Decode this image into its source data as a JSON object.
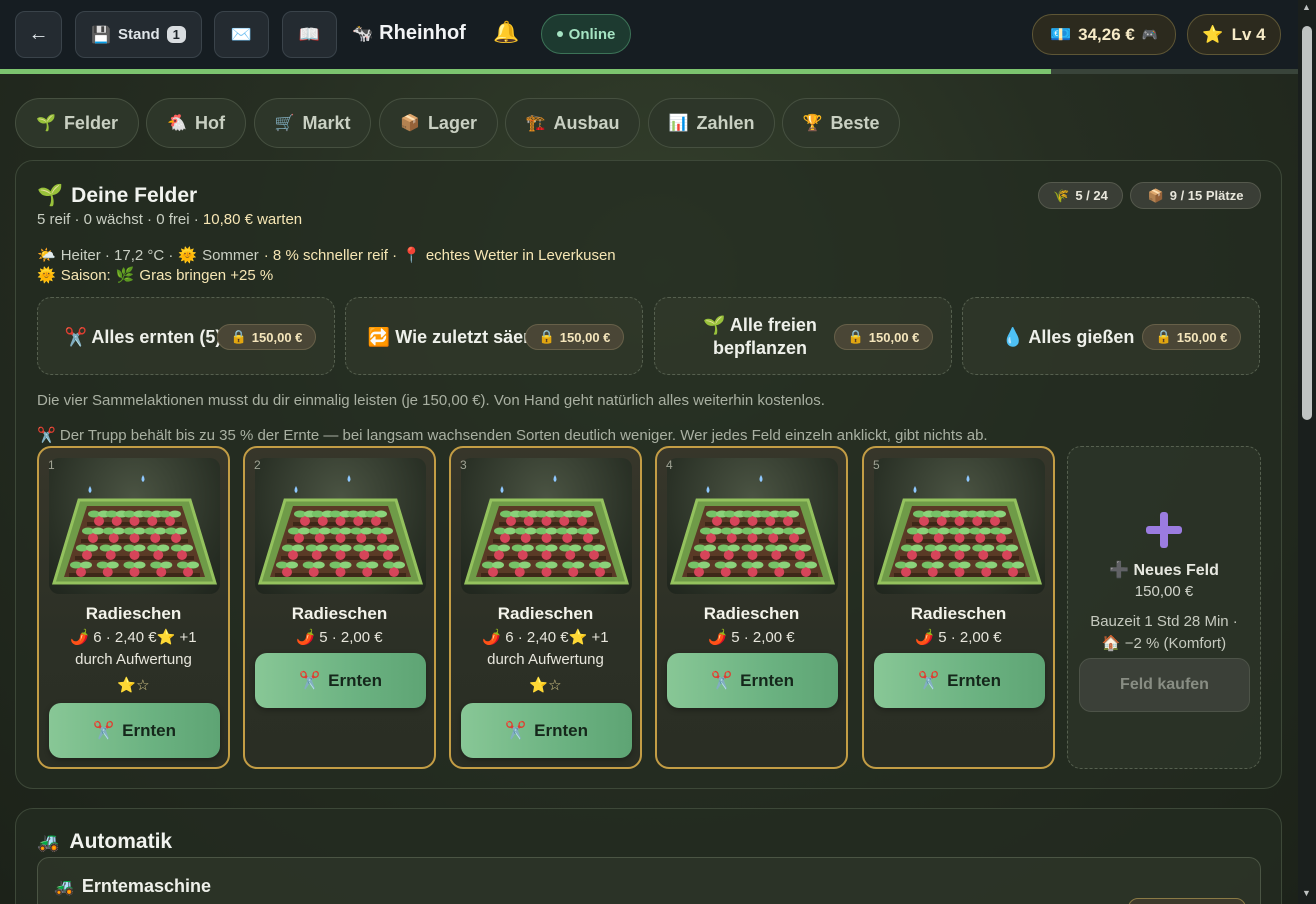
{
  "topbar": {
    "back_icon": "←",
    "save_icon": "💾",
    "save_label": "Stand",
    "save_count": "1",
    "mail_icon": "✉️",
    "book_icon": "📖",
    "farm_icon": "🐄",
    "farm_name": "Rheinhof",
    "bell_icon": "🔔",
    "online_label": "Online",
    "money_icon": "💶",
    "money": "34,26 €",
    "money_suffix_icon": "🎮",
    "level_icon": "⭐",
    "level": "Lv 4",
    "progress_fraction": 0.81
  },
  "tabs": [
    {
      "icon": "🌱",
      "label": "Felder",
      "active": true
    },
    {
      "icon": "🐔",
      "label": "Hof",
      "active": false
    },
    {
      "icon": "🛒",
      "label": "Markt",
      "active": false
    },
    {
      "icon": "📦",
      "label": "Lager",
      "active": false
    },
    {
      "icon": "🏗️",
      "label": "Ausbau",
      "active": false
    },
    {
      "icon": "📊",
      "label": "Zahlen",
      "active": false
    },
    {
      "icon": "🏆",
      "label": "Beste",
      "active": false
    }
  ],
  "fields_panel": {
    "title_icon": "🌱",
    "title": "Deine Felder",
    "subtitle": "5 reif · 0 wächst · 0 frei ·",
    "subtitle_highlight": "10,80 € warten",
    "chip_fields_icon": "🌾",
    "chip_fields": "5 / 24",
    "chip_storage_icon": "📦",
    "chip_storage": "9 / 15 Plätze",
    "weather": {
      "icon": "🌤️",
      "text": "Heiter · 17,2 °C ·",
      "season_icon": "🌞",
      "season": "Sommer",
      "bonus": "· 8 % schneller reif ·",
      "pin_icon": "📍",
      "location": "echtes Wetter in Leverkusen"
    },
    "season_line": {
      "icon": "🌞",
      "label": "Saison:",
      "grass_icon": "🌿",
      "text": "Gras bringen +25 %"
    },
    "actions": [
      {
        "icon": "✂️",
        "label": "Alles ernten (5)",
        "lock_icon": "🔒",
        "price": "150,00 €"
      },
      {
        "icon": "🔁",
        "label": "Wie zuletzt säen",
        "lock_icon": "🔒",
        "price": "150,00 €"
      },
      {
        "icon": "🌱",
        "label": "Alle freien bepflanzen",
        "lock_icon": "🔒",
        "price": "150,00 €"
      },
      {
        "icon": "💧",
        "label": "Alles gießen",
        "lock_icon": "🔒",
        "price": "150,00 €"
      }
    ],
    "note_unlock": "Die vier Sammelaktionen musst du dir einmalig leisten (je 150,00 €). Von Hand geht natürlich alles weiterhin kostenlos.",
    "note_crew_icon": "✂️",
    "note_crew": "Der Trupp behält bis zu 35 % der Ernte — bei langsam wachsenden Sorten deutlich weniger. Wer jedes Feld einzeln anklickt, gibt nichts ab.",
    "fields": [
      {
        "num": "1",
        "crop": "Radieschen",
        "crop_icon": "🌶️",
        "stat": "6 · 2,40 €",
        "bonus_icon": "⭐",
        "bonus": "+1 durch Aufwertung",
        "upgraded": true,
        "stars_filled": "⭐",
        "stars_empty": "☆",
        "button_icon": "✂️",
        "button": "Ernten"
      },
      {
        "num": "2",
        "crop": "Radieschen",
        "crop_icon": "🌶️",
        "stat": "5 · 2,00 €",
        "upgraded": false,
        "button_icon": "✂️",
        "button": "Ernten"
      },
      {
        "num": "3",
        "crop": "Radieschen",
        "crop_icon": "🌶️",
        "stat": "6 · 2,40 €",
        "bonus_icon": "⭐",
        "bonus": "+1 durch Aufwertung",
        "upgraded": true,
        "stars_filled": "⭐",
        "stars_empty": "☆",
        "button_icon": "✂️",
        "button": "Ernten"
      },
      {
        "num": "4",
        "crop": "Radieschen",
        "crop_icon": "🌶️",
        "stat": "5 · 2,00 €",
        "upgraded": false,
        "button_icon": "✂️",
        "button": "Ernten"
      },
      {
        "num": "5",
        "crop": "Radieschen",
        "crop_icon": "🌶️",
        "stat": "5 · 2,00 €",
        "upgraded": false,
        "button_icon": "✂️",
        "button": "Ernten"
      }
    ],
    "new_field": {
      "plus_icon": "➕",
      "title_icon": "➕",
      "title": "Neues Feld",
      "price": "150,00 €",
      "build_time": "Bauzeit 1 Std 28 Min ·",
      "comfort_icon": "🏠",
      "comfort": "−2 % (Komfort)",
      "button": "Feld kaufen"
    }
  },
  "automation": {
    "title_icon": "🚜",
    "title": "Automatik",
    "machine_icon": "🚜",
    "machine": "Erntemaschine"
  },
  "colors": {
    "accent_green": "#79b364",
    "gold_border": "#c39d45",
    "harvest_button": "#6bb281"
  }
}
